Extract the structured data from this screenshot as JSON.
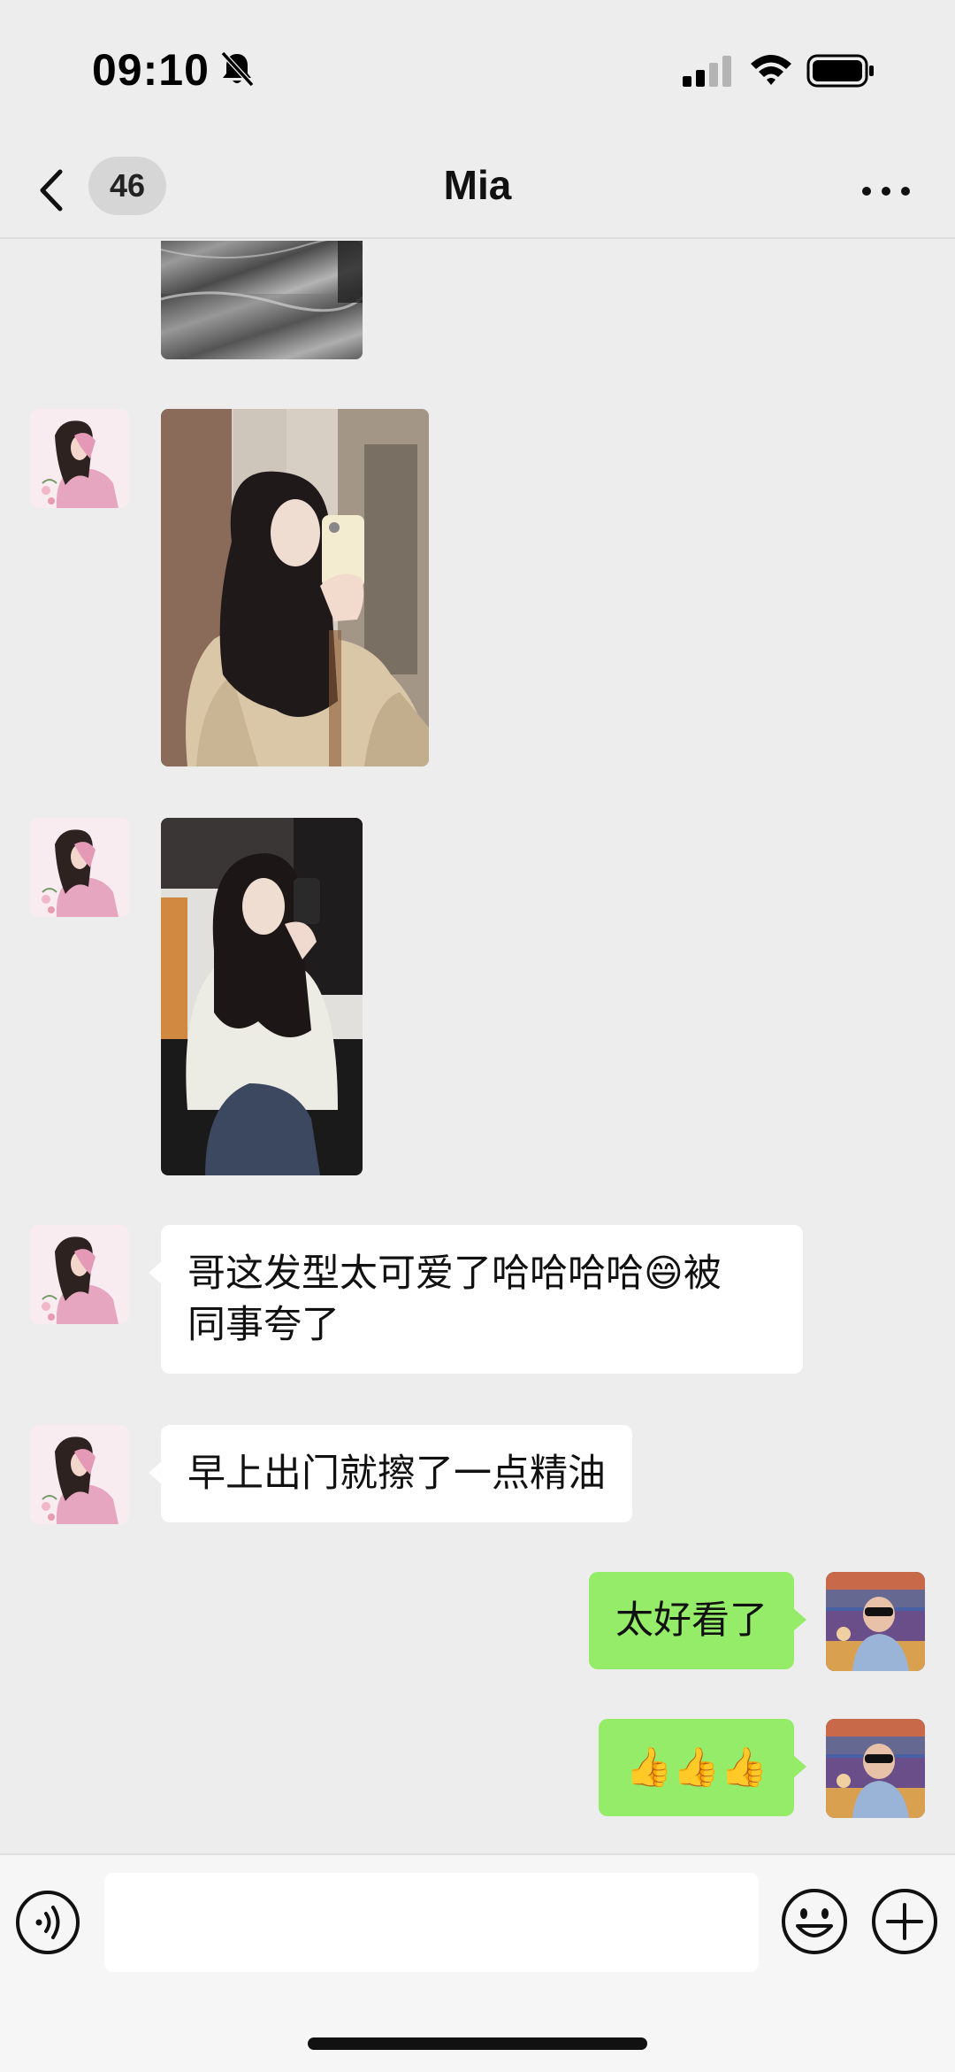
{
  "status_bar": {
    "time": "09:10",
    "icons": [
      "bell-muted-icon",
      "cellular-signal-icon",
      "wifi-icon",
      "battery-icon"
    ]
  },
  "header": {
    "unread_count": "46",
    "title": "Mia",
    "back_icon": "chevron-left-icon",
    "more_icon": "more-dots-icon"
  },
  "messages": [
    {
      "sender": "contact",
      "type": "image",
      "content": "photo-wrapped-package"
    },
    {
      "sender": "contact",
      "type": "image",
      "content": "photo-mirror-selfie-fur-coat"
    },
    {
      "sender": "contact",
      "type": "image",
      "content": "photo-salon-chair-selfie"
    },
    {
      "sender": "contact",
      "type": "text",
      "text_line1": "哥这发型太可爱了哈哈哈哈😄被",
      "text_line2": "同事夸了"
    },
    {
      "sender": "contact",
      "type": "text",
      "text": "早上出门就擦了一点精油"
    },
    {
      "sender": "me",
      "type": "text",
      "text": "太好看了"
    },
    {
      "sender": "me",
      "type": "text",
      "text": "👍👍👍"
    }
  ],
  "input_bar": {
    "value": "",
    "voice_icon": "voice-icon",
    "emoji_icon": "emoji-icon",
    "plus_icon": "plus-icon"
  },
  "colors": {
    "background": "#ededed",
    "incoming_bubble": "#ffffff",
    "outgoing_bubble": "#95ec69",
    "input_bar": "#f6f6f6"
  }
}
